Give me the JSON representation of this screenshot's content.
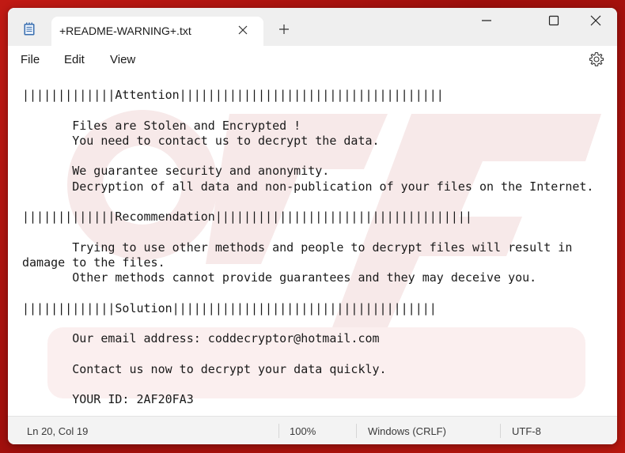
{
  "tab": {
    "title": "+README-WARNING+.txt"
  },
  "menu": {
    "file": "File",
    "edit": "Edit",
    "view": "View"
  },
  "icons": {
    "app": "notepad-icon",
    "close_tab": "close-icon",
    "new_tab": "plus-icon",
    "minimize": "minimize-icon",
    "maximize": "maximize-icon",
    "close_window": "close-icon",
    "settings": "gear-icon"
  },
  "document": {
    "lines": [
      "|||||||||||||Attention|||||||||||||||||||||||||||||||||||||",
      "",
      "       Files are Stolen and Encrypted !",
      "       You need to contact us to decrypt the data.",
      "",
      "       We guarantee security and anonymity.",
      "       Decryption of all data and non-publication of your files on the Internet.",
      "",
      "|||||||||||||Recommendation||||||||||||||||||||||||||||||||||||",
      "",
      "       Trying to use other methods and people to decrypt files will result in",
      "damage to the files.",
      "       Other methods cannot provide guarantees and they may deceive you.",
      "",
      "|||||||||||||Solution|||||||||||||||||||||||||||||||||||||",
      "",
      "       Our email address: coddecryptor@hotmail.com",
      "",
      "       Contact us now to decrypt your data quickly.",
      "",
      "       YOUR ID: 2AF20FA3"
    ]
  },
  "status": {
    "position": "Ln 20, Col 19",
    "zoom": "100%",
    "line_ending": "Windows (CRLF)",
    "encoding": "UTF-8"
  },
  "colors": {
    "desktop_background": "#b8170f",
    "titlebar": "#efefef",
    "statusbar": "#f3f3f3",
    "watermark": "#f7e9e9"
  }
}
